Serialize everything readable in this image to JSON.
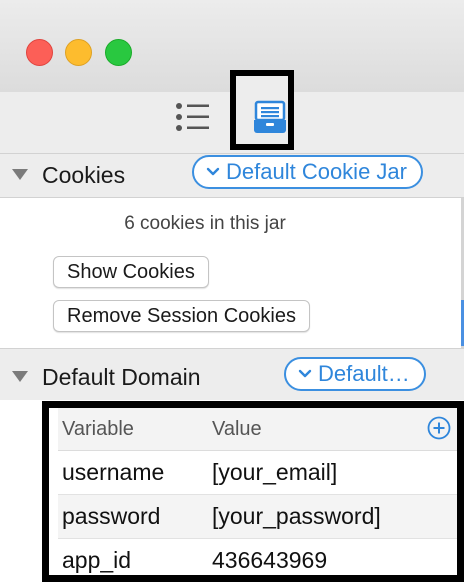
{
  "window": {
    "traffic_lights": {
      "close": "#fc5f57",
      "minimize": "#fdbc2e",
      "maximize": "#29c840"
    }
  },
  "toolbar": {
    "icons": [
      "list-icon",
      "cookie-jar-icon"
    ],
    "accent": "#3b8fe0"
  },
  "cookies_section": {
    "title": "Cookies",
    "jar_button": "Default Cookie Jar",
    "count_text": "6 cookies in this jar",
    "show_button": "Show Cookies",
    "remove_button": "Remove Session Cookies"
  },
  "domain_section": {
    "title": "Default Domain",
    "domain_button": "Default…"
  },
  "variables_table": {
    "columns": [
      "Variable",
      "Value"
    ],
    "rows": [
      {
        "variable": "username",
        "value": "[your_email]"
      },
      {
        "variable": "password",
        "value": "[your_password]"
      },
      {
        "variable": "app_id",
        "value": "436643969"
      }
    ]
  }
}
